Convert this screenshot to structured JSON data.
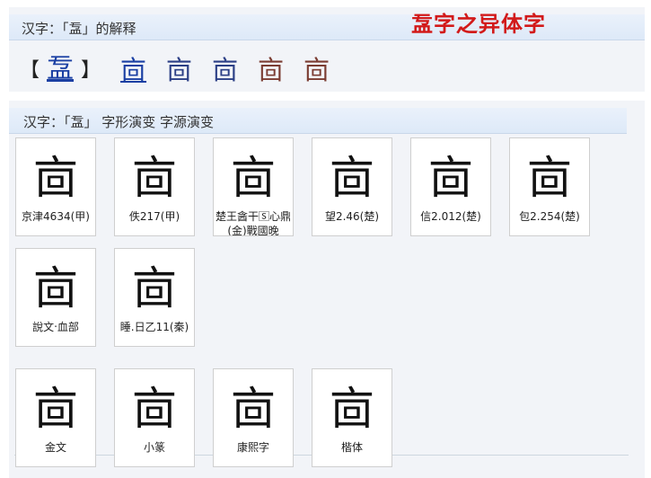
{
  "top": {
    "header_title": "汉字：「𥁄」的解释",
    "variant_title": "𥁄字之异体字",
    "bracket_left": "【",
    "bracket_right": "】",
    "main_char": "𥁄",
    "variants": [
      {
        "char": "㐭",
        "style": "link"
      },
      {
        "char": "㐭",
        "style": "plain"
      },
      {
        "char": "㐭",
        "style": "plain"
      },
      {
        "char": "㐭",
        "style": "image"
      },
      {
        "char": "㐭",
        "style": "image"
      }
    ]
  },
  "evolution": {
    "header_title": "汉字：「𥁄」 字形演变 字源演变",
    "row1": [
      {
        "glyph": "㐭",
        "caption": "京津4634(甲)"
      },
      {
        "glyph": "㐭",
        "caption": "佚217(甲)"
      },
      {
        "glyph": "㐭",
        "caption": "楚王酓干🅂心鼎(金)戰國晚"
      },
      {
        "glyph": "㐭",
        "caption": "望2.46(楚)"
      },
      {
        "glyph": "㐭",
        "caption": "信2.012(楚)"
      },
      {
        "glyph": "㐭",
        "caption": "包2.254(楚)"
      }
    ],
    "row2": [
      {
        "glyph": "㐭",
        "caption": "說文‧血部"
      },
      {
        "glyph": "㐭",
        "caption": "睡.日乙11(秦)"
      }
    ],
    "row3": [
      {
        "glyph": "㐭",
        "caption": "金文"
      },
      {
        "glyph": "㐭",
        "caption": "小篆"
      },
      {
        "glyph": "㐭",
        "caption": "康熙字"
      },
      {
        "glyph": "㐭",
        "caption": "楷体"
      }
    ]
  }
}
